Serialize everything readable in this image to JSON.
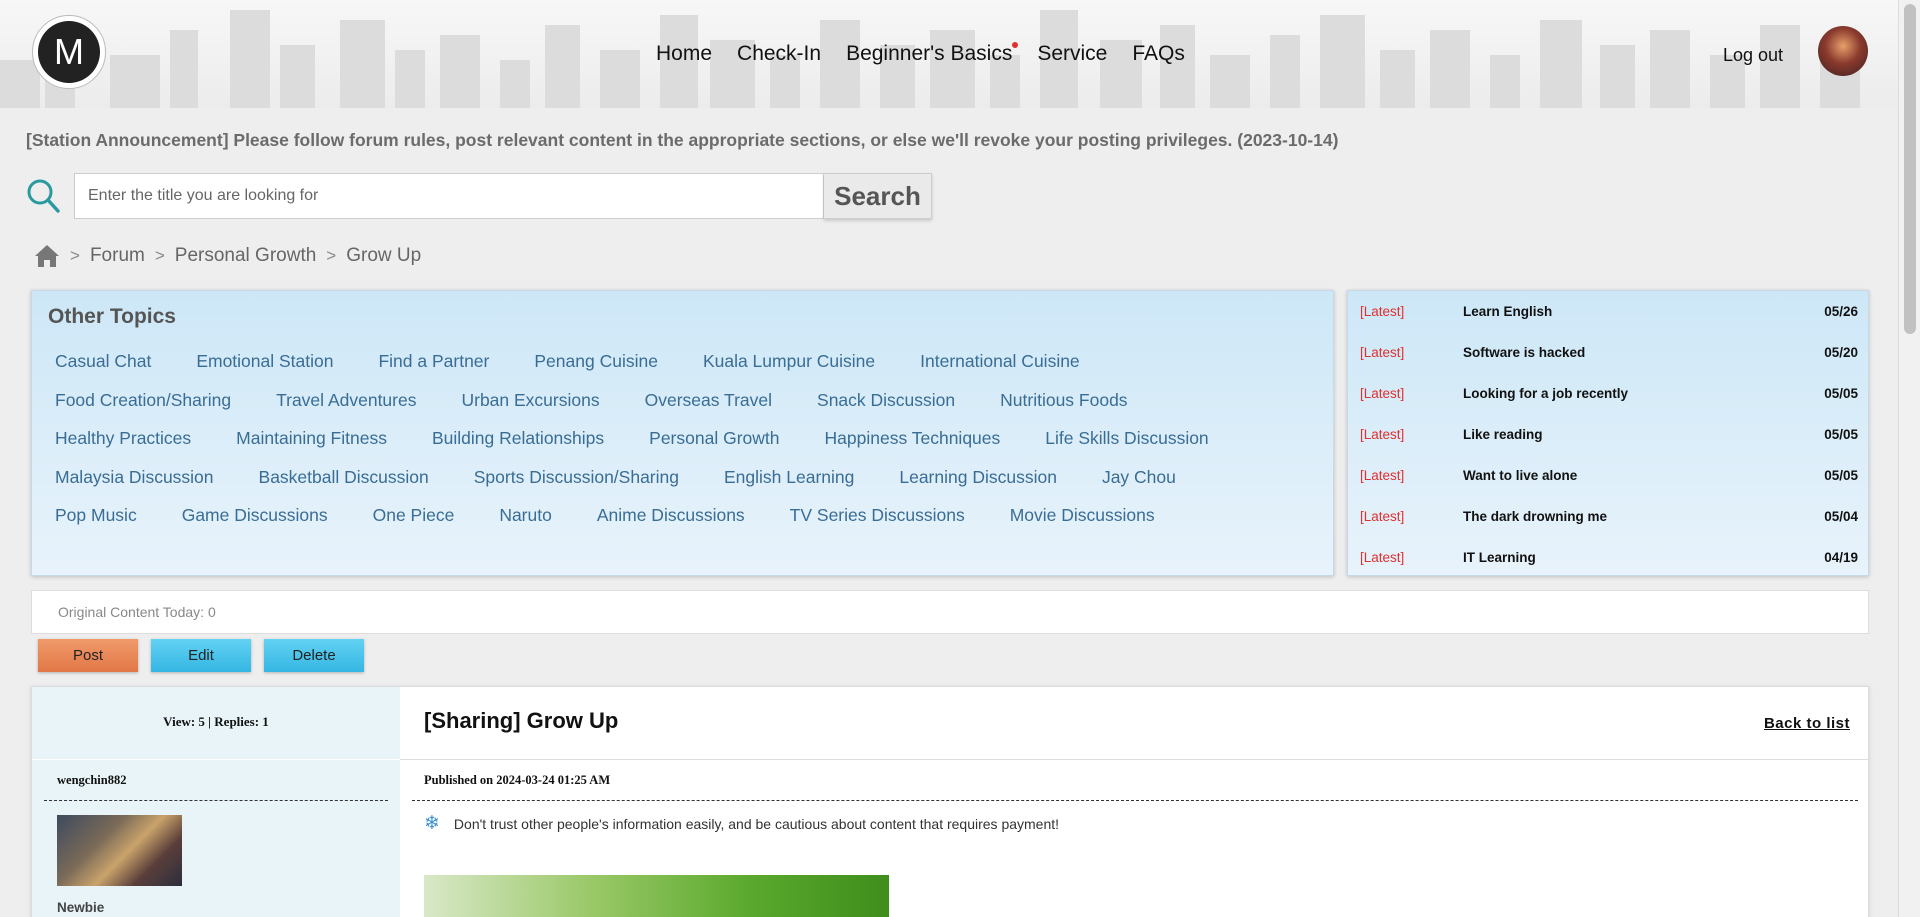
{
  "header": {
    "logo_letter": "M",
    "nav": [
      "Home",
      "Check-In",
      "Beginner's Basics",
      "Service",
      "FAQs"
    ],
    "logout": "Log out"
  },
  "announcement": "[Station Announcement] Please follow forum rules, post relevant content in the appropriate sections, or else we'll revoke your posting privileges. (2023-10-14)",
  "search": {
    "placeholder": "Enter the title you are looking for",
    "button": "Search"
  },
  "breadcrumb": [
    "Forum",
    "Personal Growth",
    "Grow Up"
  ],
  "other_topics": {
    "title": "Other Topics",
    "rows": [
      [
        "Casual Chat",
        "Emotional Station",
        "Find a Partner",
        "Penang Cuisine",
        "Kuala Lumpur Cuisine",
        "International Cuisine"
      ],
      [
        "Food Creation/Sharing",
        "Travel Adventures",
        "Urban Excursions",
        "Overseas Travel",
        "Snack Discussion",
        "Nutritious Foods"
      ],
      [
        "Healthy Practices",
        "Maintaining Fitness",
        "Building Relationships",
        "Personal Growth",
        "Happiness Techniques",
        "Life Skills Discussion"
      ],
      [
        "Malaysia Discussion",
        "Basketball Discussion",
        "Sports Discussion/Sharing",
        "English Learning",
        "Learning Discussion",
        "Jay Chou"
      ],
      [
        "Pop Music",
        "Game Discussions",
        "One Piece",
        "Naruto",
        "Anime Discussions",
        "TV Series Discussions",
        "Movie Discussions"
      ]
    ]
  },
  "latest": [
    {
      "tag": "[Latest]",
      "title": "Learn English",
      "date": "05/26"
    },
    {
      "tag": "[Latest]",
      "title": "Software is hacked",
      "date": "05/20"
    },
    {
      "tag": "[Latest]",
      "title": "Looking for a job recently",
      "date": "05/05"
    },
    {
      "tag": "[Latest]",
      "title": "Like reading",
      "date": "05/05"
    },
    {
      "tag": "[Latest]",
      "title": "Want to live alone",
      "date": "05/05"
    },
    {
      "tag": "[Latest]",
      "title": "The dark drowning me",
      "date": "05/04"
    },
    {
      "tag": "[Latest]",
      "title": "IT Learning",
      "date": "04/19"
    }
  ],
  "today": "Original Content Today: 0",
  "actions": {
    "post": "Post",
    "edit": "Edit",
    "delete": "Delete"
  },
  "thread": {
    "stats": "View: 5 | Replies: 1",
    "username": "wengchin882",
    "rank": "Newbie",
    "title": "[Sharing] Grow Up",
    "back": "Back to list",
    "published": "Published on 2024-03-24 01:25 AM",
    "warning": "Don't trust other people's information easily, and be cautious about content that requires payment!"
  },
  "colors": {
    "latest_tag": "#e0302f",
    "topic_link": "#3a6d95",
    "post_button": "#e27747",
    "blue_button": "#34b6e3"
  }
}
